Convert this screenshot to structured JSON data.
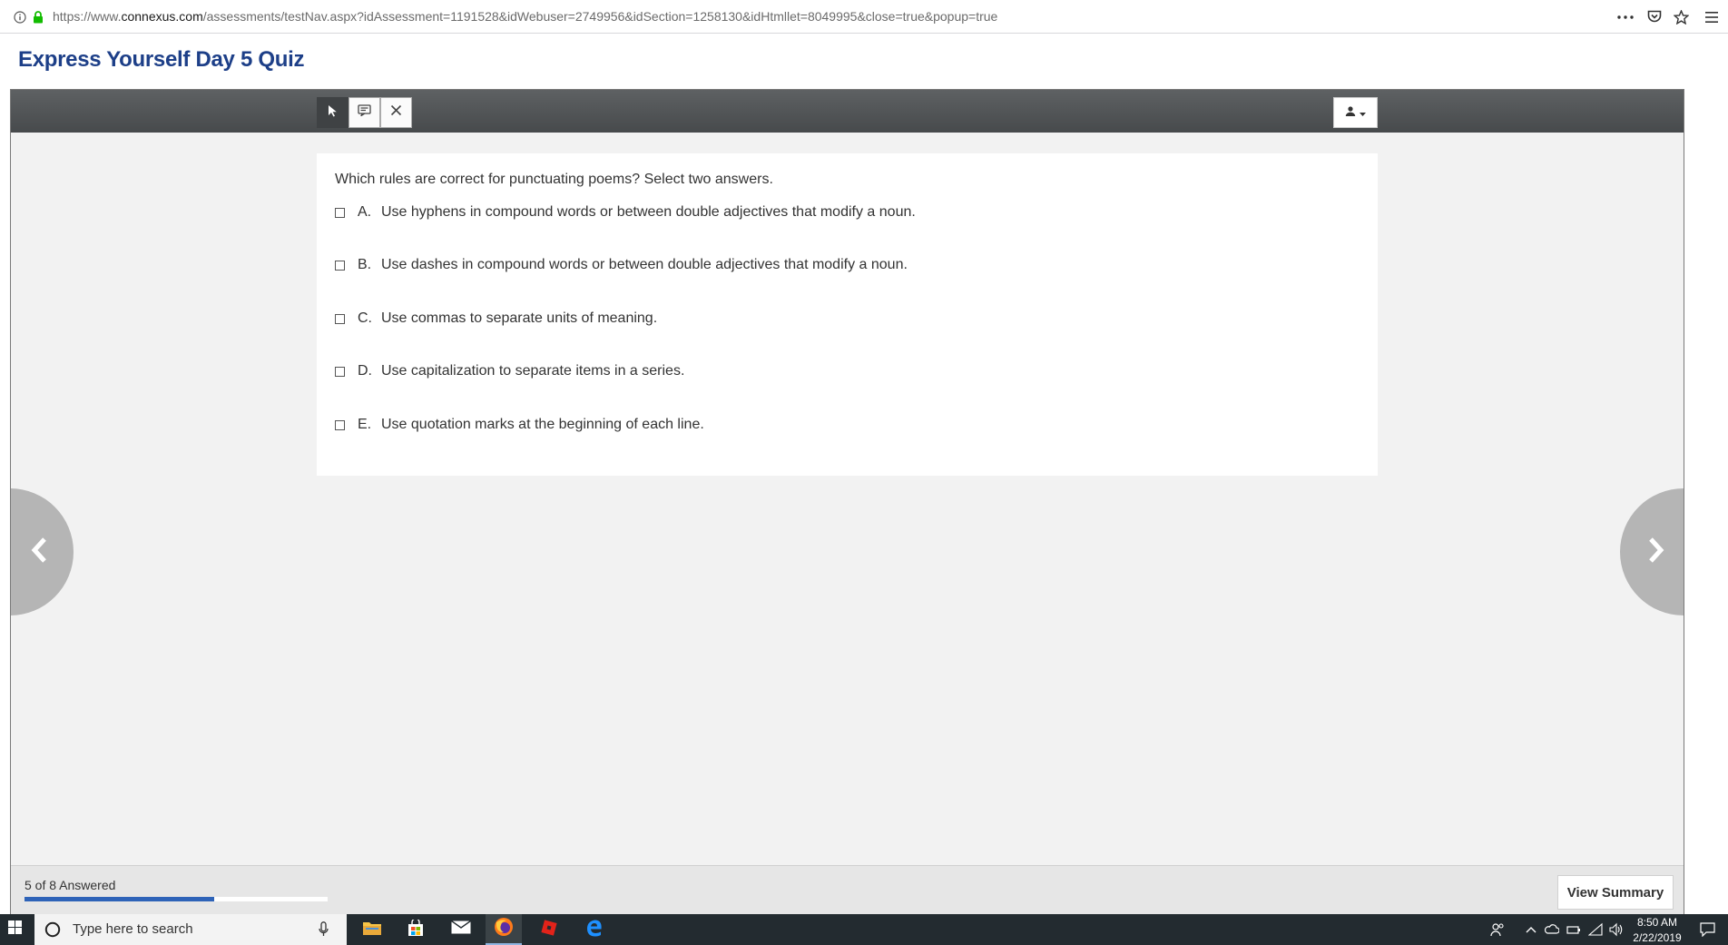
{
  "browser": {
    "url_prefix": "https://www.",
    "url_host": "connexus.com",
    "url_path": "/assessments/testNav.aspx?idAssessment=1191528&idWebuser=2749956&idSection=1258130&idHtmllet=8049995&close=true&popup=true"
  },
  "page": {
    "title": "Express Yourself Day 5 Quiz"
  },
  "toolbar": {
    "tools": [
      "pointer-tool",
      "annotate-tool",
      "eliminate-tool"
    ],
    "user_menu": "user-menu"
  },
  "question": {
    "prompt": "Which rules are correct for punctuating poems? Select two answers.",
    "options": [
      {
        "letter": "A.",
        "text": "Use hyphens in compound words or between double adjectives that modify a noun.",
        "checked": false
      },
      {
        "letter": "B.",
        "text": "Use dashes in compound words or between double adjectives that modify a noun.",
        "checked": false
      },
      {
        "letter": "C.",
        "text": "Use commas to separate units of meaning.",
        "checked": false
      },
      {
        "letter": "D.",
        "text": "Use capitalization to separate items in a series.",
        "checked": false
      },
      {
        "letter": "E.",
        "text": "Use quotation marks at the beginning of each line.",
        "checked": false
      }
    ]
  },
  "footer": {
    "answered_text": "5 of 8 Answered",
    "answered": 5,
    "total": 8,
    "view_summary_label": "View Summary"
  },
  "taskbar": {
    "search_placeholder": "Type here to search",
    "time": "8:50 AM",
    "date": "2/22/2019",
    "apps": [
      "file-explorer",
      "store",
      "mail",
      "firefox",
      "roblox",
      "edge"
    ]
  },
  "colors": {
    "title": "#1d3f88",
    "toolbar": "#4f5254",
    "progress": "#2e63b8",
    "background": "#f2f2f2"
  }
}
